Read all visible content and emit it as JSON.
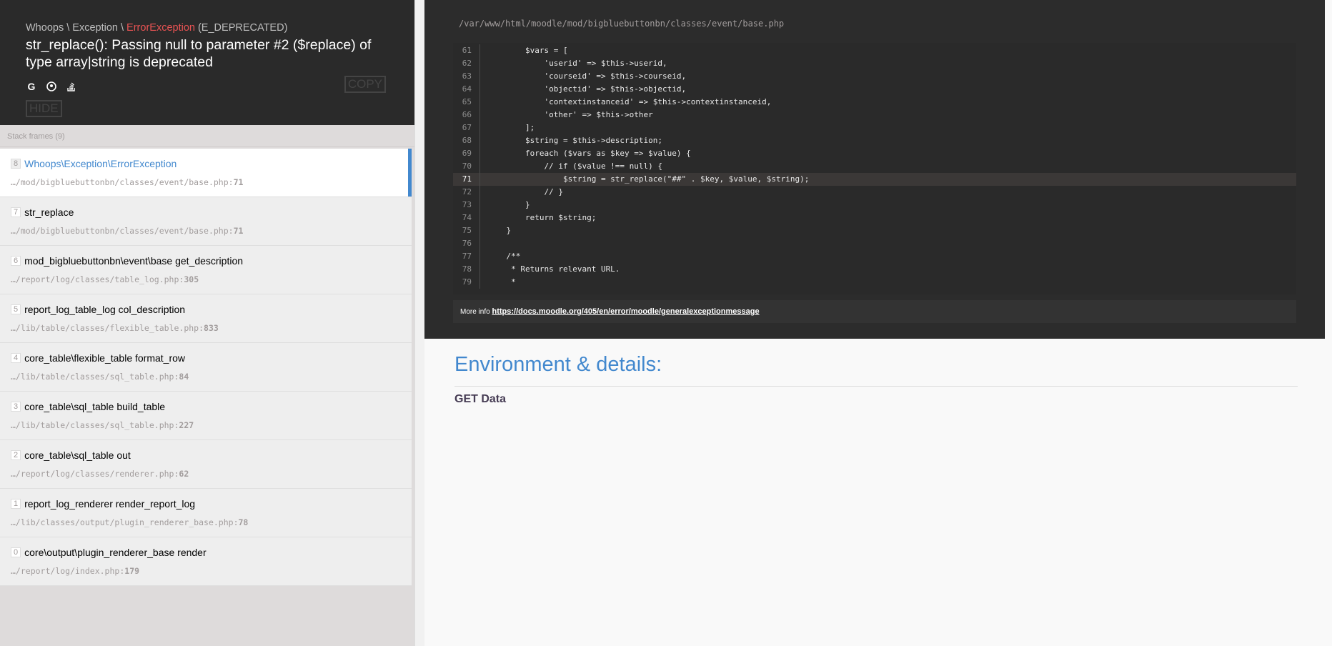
{
  "header": {
    "breadcrumb_prefix": "Whoops \\ Exception \\ ",
    "error_class": "ErrorException",
    "error_code": " (E_DEPRECATED)",
    "message": "str_replace(): Passing null to parameter #2 ($replace) of type array|string is deprecated",
    "copy_label": "COPY",
    "hide_label": "HIDE",
    "icons": [
      "google-icon",
      "duckduckgo-icon",
      "stackoverflow-icon"
    ]
  },
  "frames_title": "Stack frames (9)",
  "frames": [
    {
      "index": "8",
      "name": "Whoops\\Exception\\ErrorException",
      "file": "…/mod/bigbluebuttonbn/classes/event/base.php",
      "line": "71"
    },
    {
      "index": "7",
      "name": "str_replace",
      "file": "…/mod/bigbluebuttonbn/classes/event/base.php",
      "line": "71"
    },
    {
      "index": "6",
      "name": "mod_bigbluebuttonbn\\event\\base get_description",
      "file": "…/report/log/classes/table_log.php",
      "line": "305"
    },
    {
      "index": "5",
      "name": "report_log_table_log col_description",
      "file": "…/lib/table/classes/flexible_table.php",
      "line": "833"
    },
    {
      "index": "4",
      "name": "core_table\\flexible_table format_row",
      "file": "…/lib/table/classes/sql_table.php",
      "line": "84"
    },
    {
      "index": "3",
      "name": "core_table\\sql_table build_table",
      "file": "…/lib/table/classes/sql_table.php",
      "line": "227"
    },
    {
      "index": "2",
      "name": "core_table\\sql_table out",
      "file": "…/report/log/classes/renderer.php",
      "line": "62"
    },
    {
      "index": "1",
      "name": "report_log_renderer render_report_log",
      "file": "…/lib/classes/output/plugin_renderer_base.php",
      "line": "78"
    },
    {
      "index": "0",
      "name": "core\\output\\plugin_renderer_base render",
      "file": "…/report/log/index.php",
      "line": "179"
    }
  ],
  "code": {
    "path": "/var/www/html/moodle/mod/bigbluebuttonbn/classes/event/base.php",
    "highlight_line": "71",
    "lines": [
      {
        "n": "61",
        "t": "        $vars = ["
      },
      {
        "n": "62",
        "t": "            'userid' => $this->userid,"
      },
      {
        "n": "63",
        "t": "            'courseid' => $this->courseid,"
      },
      {
        "n": "64",
        "t": "            'objectid' => $this->objectid,"
      },
      {
        "n": "65",
        "t": "            'contextinstanceid' => $this->contextinstanceid,"
      },
      {
        "n": "66",
        "t": "            'other' => $this->other"
      },
      {
        "n": "67",
        "t": "        ];"
      },
      {
        "n": "68",
        "t": "        $string = $this->description;"
      },
      {
        "n": "69",
        "t": "        foreach ($vars as $key => $value) {"
      },
      {
        "n": "70",
        "t": "            // if ($value !== null) {"
      },
      {
        "n": "71",
        "t": "                $string = str_replace(\"##\" . $key, $value, $string);"
      },
      {
        "n": "72",
        "t": "            // }"
      },
      {
        "n": "73",
        "t": "        }"
      },
      {
        "n": "74",
        "t": "        return $string;"
      },
      {
        "n": "75",
        "t": "    }"
      },
      {
        "n": "76",
        "t": ""
      },
      {
        "n": "77",
        "t": "    /**"
      },
      {
        "n": "78",
        "t": "     * Returns relevant URL."
      },
      {
        "n": "79",
        "t": "     *"
      }
    ]
  },
  "more_info": {
    "label": "More info ",
    "url": "https://docs.moodle.org/405/en/error/moodle/generalexceptionmessage"
  },
  "env": {
    "title": "Environment & details:",
    "get_data": "GET Data"
  }
}
